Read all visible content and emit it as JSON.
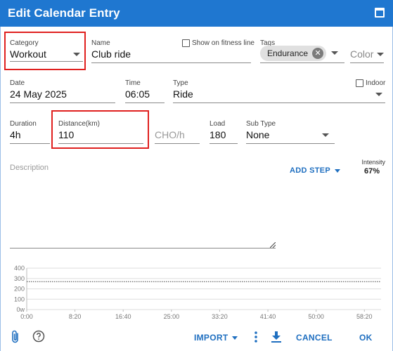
{
  "window": {
    "title": "Edit Calendar Entry"
  },
  "fields": {
    "category": {
      "label": "Category",
      "value": "Workout"
    },
    "name": {
      "label": "Name",
      "value": "Club ride"
    },
    "show_on_fitness_line": {
      "label": "Show on fitness line",
      "checked": false
    },
    "tags": {
      "label": "Tags",
      "chip": "Endurance"
    },
    "color": {
      "placeholder": "Color"
    },
    "date": {
      "label": "Date",
      "value": "24 May 2025"
    },
    "time": {
      "label": "Time",
      "value": "06:05"
    },
    "type": {
      "label": "Type",
      "value": "Ride"
    },
    "indoor": {
      "label": "Indoor",
      "checked": false
    },
    "duration": {
      "label": "Duration",
      "value": "4h"
    },
    "distance": {
      "label": "Distance(km)",
      "value": "110"
    },
    "cho": {
      "placeholder": "CHO/h"
    },
    "load": {
      "label": "Load",
      "value": "180"
    },
    "sub_type": {
      "label": "Sub Type",
      "value": "None"
    },
    "description": {
      "placeholder": "Description"
    },
    "intensity": {
      "label": "Intensity",
      "value": "67%"
    }
  },
  "buttons": {
    "add_step": "ADD STEP",
    "import": "IMPORT",
    "cancel": "CANCEL",
    "ok": "OK"
  },
  "chart_data": {
    "type": "line",
    "y_ticks": [
      "400",
      "300",
      "200",
      "100",
      "0w"
    ],
    "x_ticks": [
      "0:00",
      "8:20",
      "16:40",
      "25:00",
      "33:20",
      "41:40",
      "50:00",
      "58:20"
    ],
    "ylim": [
      0,
      400
    ],
    "xlim": [
      0,
      3600
    ],
    "reference_line": {
      "value": 270,
      "style": "dotted"
    },
    "grid": true
  },
  "colors": {
    "title_bar": "#1f77d0",
    "accent": "#1f6fc0",
    "highlight_box": "#e0201f",
    "chip_bg": "#e0e0e0"
  },
  "icons": {
    "attach": "paperclip-icon",
    "help": "help-circle-icon",
    "more": "more-vertical-icon",
    "download": "download-icon",
    "maximize": "maximize-icon"
  }
}
